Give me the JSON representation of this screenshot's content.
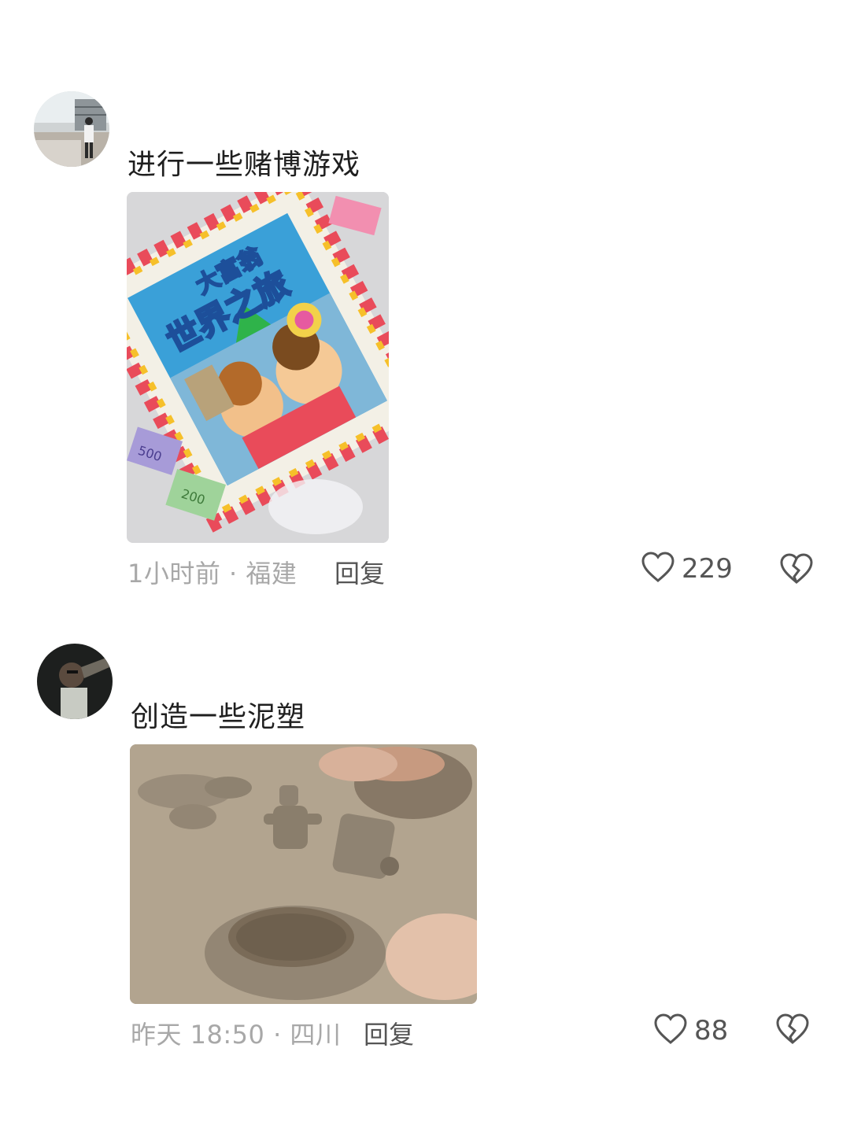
{
  "comments": [
    {
      "text": "进行一些赌博游戏",
      "meta": "1小时前 · 福建",
      "reply_label": "回复",
      "like_count": "229",
      "image_labels": {
        "title_top": "大富翁",
        "title_main": "世界之旅",
        "bill_500": "500",
        "bill_200": "200"
      }
    },
    {
      "text": "创造一些泥塑",
      "meta": "昨天 18:50 · 四川",
      "reply_label": "回复",
      "like_count": "88"
    }
  ],
  "colors": {
    "text": "#1f1f1f",
    "meta": "#a8a8a8",
    "action": "#555555",
    "background": "#ffffff"
  },
  "icons": {
    "like": "heart-outline-icon",
    "dislike": "broken-heart-icon"
  }
}
